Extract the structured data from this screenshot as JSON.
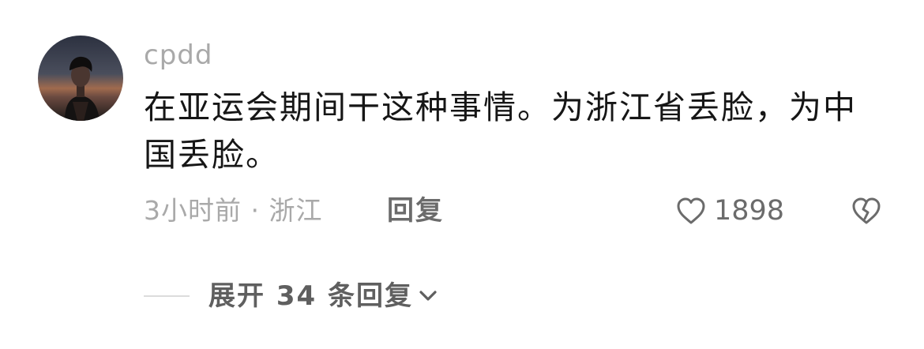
{
  "comment": {
    "username": "cpdd",
    "text": "在亚运会期间干这种事情。为浙江省丢脸，为中国丢脸。",
    "meta": "3小时前 · 浙江",
    "reply_label": "回复",
    "like_count": "1898",
    "expand_replies_label": "展开 34 条回复"
  },
  "icons": {
    "like": "heart-outline-icon",
    "dislike": "broken-heart-icon",
    "expand": "chevron-down-icon"
  },
  "colors": {
    "username": "#a9a9a9",
    "text": "#161616",
    "meta": "#a9a9a9",
    "action": "#6b6b6b",
    "divider": "#dcdcdc"
  }
}
